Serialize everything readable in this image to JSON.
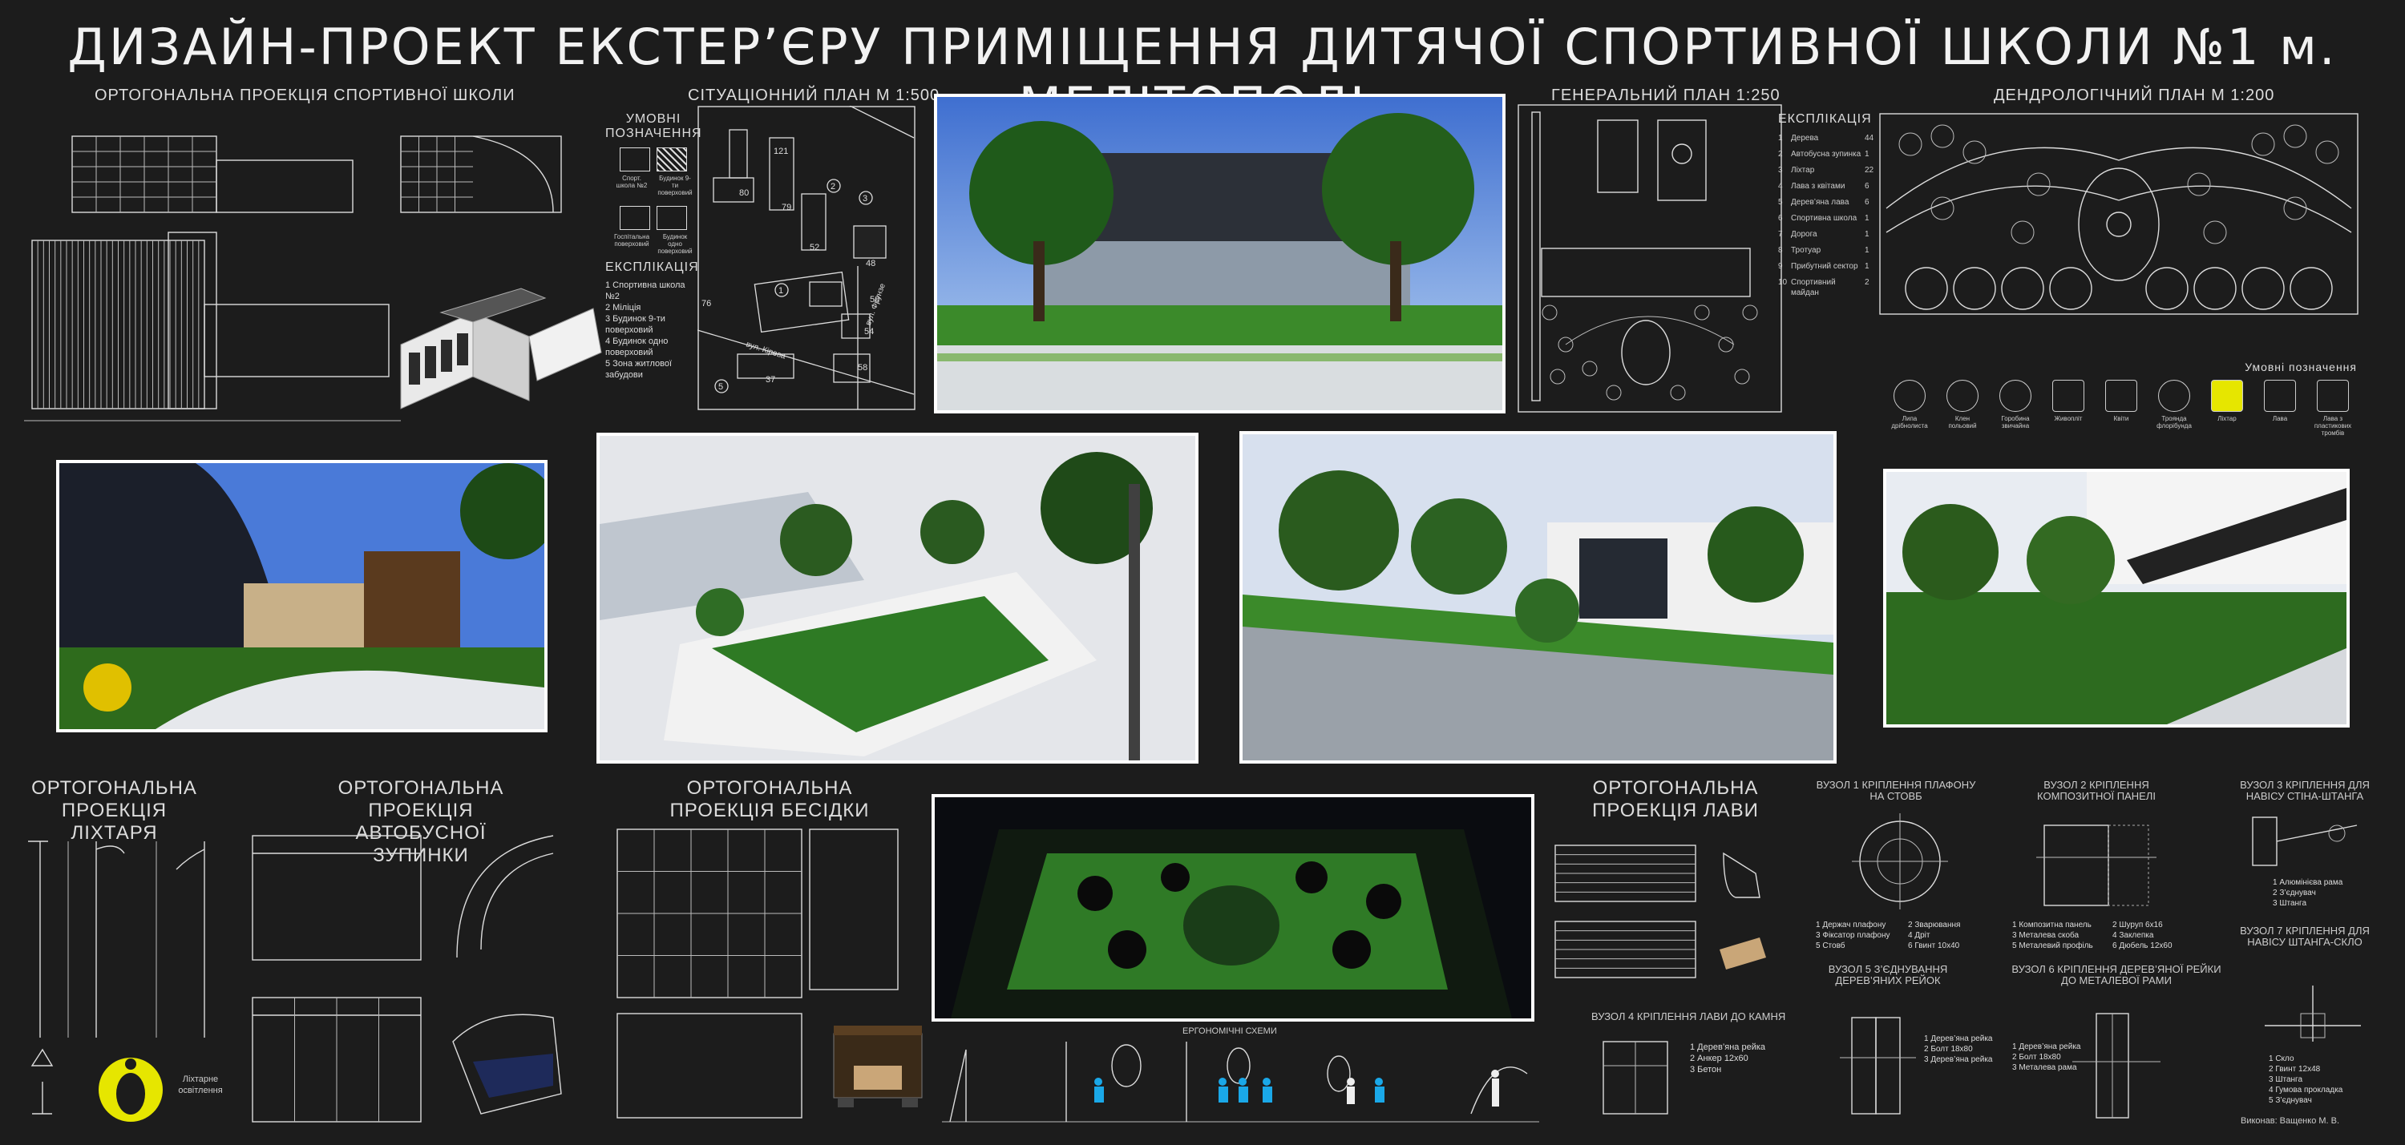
{
  "title": "ДИЗАЙН-ПРОЕКТ ЕКСТЕР’ЄРУ ПРИМІЩЕННЯ ДИТЯЧОЇ СПОРТИВНОЇ ШКОЛИ №1 м. МЕЛІТОПОЛЬ",
  "labels": {
    "ortho_school": "ОРТОГОНАЛЬНА ПРОЕКЦІЯ СПОРТИВНОЇ ШКОЛИ",
    "site_plan": "СІТУАЦІОННИЙ ПЛАН М 1:500",
    "general_plan": "ГЕНЕРАЛЬНИЙ ПЛАН 1:250",
    "dendro_plan": "ДЕНДРОЛОГІЧНИЙ ПЛАН М 1:200",
    "ortho_lamp": "ОРТОГОНАЛЬНА ПРОЕКЦІЯ ЛІХТАРЯ",
    "ortho_bus": "ОРТОГОНАЛЬНА ПРОЕКЦІЯ АВТОБУСНОЇ ЗУПИНКИ",
    "ortho_gazebo": "ОРТОГОНАЛЬНА ПРОЕКЦІЯ БЕСІДКИ",
    "ortho_bench": "ОРТОГОНАЛЬНА ПРОЕКЦІЯ ЛАВИ",
    "ergonomic": "ЕРГОНОМІЧНІ СХЕМИ",
    "author": "Виконав: Ващенко М. В."
  },
  "legend_symbols": {
    "title": "УМОВНІ ПОЗНАЧЕННЯ",
    "items": [
      "Спорт. школа №2",
      "Будинок 9-ти поверховий",
      "Госпітальна поверховий",
      "Будинок одно поверховий"
    ]
  },
  "explication_site": {
    "title": "ЕКСПЛІКАЦІЯ",
    "items": [
      "1  Спортивна школа №2",
      "2  Міліція",
      "3  Будинок 9-ти поверховий",
      "4  Будинок одно поверховий",
      "5  Зона житлової забудови"
    ]
  },
  "explication_general": {
    "title": "ЕКСПЛІКАЦІЯ",
    "items": [
      {
        "n": "1",
        "name": "Дерева",
        "q": "44"
      },
      {
        "n": "2",
        "name": "Автобусна зупинка",
        "q": "1"
      },
      {
        "n": "3",
        "name": "Ліхтар",
        "q": "22"
      },
      {
        "n": "4",
        "name": "Лава з квітами",
        "q": "6"
      },
      {
        "n": "5",
        "name": "Дерев’яна лава",
        "q": "6"
      },
      {
        "n": "6",
        "name": "Спортивна школа",
        "q": "1"
      },
      {
        "n": "7",
        "name": "Дорога",
        "q": "1"
      },
      {
        "n": "8",
        "name": "Тротуар",
        "q": "1"
      },
      {
        "n": "9",
        "name": "Прибутний сектор",
        "q": "1"
      },
      {
        "n": "10",
        "name": "Спортивний майдан",
        "q": "2"
      }
    ]
  },
  "dendro_legend": {
    "title": "Умовні позначення",
    "items": [
      "Липа дрібнолиста",
      "Клен польовий",
      "Горобина звичайна",
      "Живопліт",
      "Квіти",
      "Троянда флорібунда",
      "Ліхтар",
      "Лава",
      "Лава з пластикових тромбів"
    ]
  },
  "site_numbers": [
    "121",
    "80",
    "79",
    "52",
    "48",
    "50",
    "54",
    "58",
    "37",
    "76",
    "5",
    "1",
    "2",
    "3"
  ],
  "streets": [
    "вул. Фрунзе",
    "вул. Кірова"
  ],
  "lamp_caption": "Ліхтарне освітлення",
  "nodes": [
    {
      "title": "ВУЗОЛ 1  КРІПЛЕННЯ ПЛАФОНУ НА СТОВБ",
      "items": [
        "1  Держач плафону",
        "2  Зварювання",
        "3  Фіксатор плафону",
        "4  Дріт",
        "5  Стовб",
        "6  Гвинт 10х40"
      ]
    },
    {
      "title": "ВУЗОЛ 2  КРІПЛЕННЯ КОМПОЗИТНОЇ ПАНЕЛІ",
      "items": [
        "1  Композитна панель",
        "2  Шуруп 6х16",
        "3  Металева скоба",
        "4  Заклепка",
        "5  Металевий профіль",
        "6  Дюбель 12х60"
      ]
    },
    {
      "title": "ВУЗОЛ 3  КРІПЛЕННЯ ДЛЯ НАВІСУ СТІНА-ШТАНГА",
      "items": [
        "1  Алюмінієва рама",
        "2  З’єднувач",
        "3  Штанга"
      ]
    },
    {
      "title": "ВУЗОЛ 4  КРІПЛЕННЯ ЛАВИ ДО КАМНЯ",
      "items": [
        "1  Дерев’яна рейка",
        "2  Анкер 12х60",
        "3  Бетон"
      ]
    },
    {
      "title": "ВУЗОЛ 5  З’ЄДНУВАННЯ ДЕРЕВ’ЯНИХ РЕЙОК",
      "items": [
        "1  Дерев’яна рейка",
        "2  Болт 18х80",
        "3  Дерев’яна рейка"
      ]
    },
    {
      "title": "ВУЗОЛ 6  КРІПЛЕННЯ ДЕРЕВ’ЯНОЇ РЕЙКИ ДО МЕТАЛЕВОЇ РАМИ",
      "items": [
        "1  Дерев’яна рейка",
        "2  Болт 18х80",
        "3  Металева рама"
      ]
    },
    {
      "title": "ВУЗОЛ 7  КРІПЛЕННЯ ДЛЯ НАВІСУ ШТАНГА-СКЛО",
      "items": [
        "1  Скло",
        "2  Гвинт 12х48",
        "3  Штанга",
        "4  Гумова прокладка",
        "5  З’єднувач"
      ]
    }
  ],
  "colors": {
    "background": "#1c1c1c",
    "line": "#dcdcdc",
    "photo_border": "#ffffff",
    "logo": "#e6e600"
  }
}
